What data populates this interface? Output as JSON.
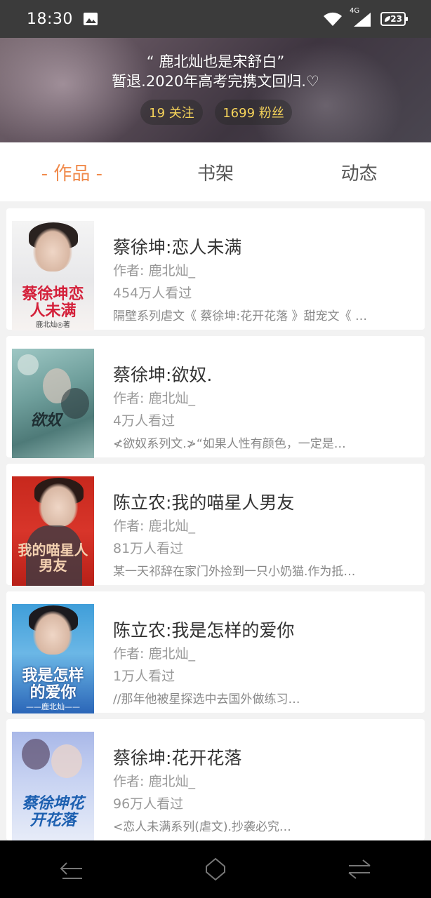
{
  "status_bar": {
    "time": "18:30",
    "network": "4G",
    "battery": "23",
    "icons": [
      "image-icon",
      "wifi-icon",
      "signal-icon",
      "battery-icon"
    ]
  },
  "header": {
    "bio_line1": "“ 鹿北灿也是宋舒白”",
    "bio_line2": "暂退.2020年高考完携文回归.♡",
    "follow_label": "19 关注",
    "fans_label": "1699 粉丝"
  },
  "tabs": [
    {
      "label": "- 作品 -",
      "active": true
    },
    {
      "label": "书架",
      "active": false
    },
    {
      "label": "动态",
      "active": false
    }
  ],
  "books": [
    {
      "title": "蔡徐坤:恋人未满",
      "author": "作者: 鹿北灿_",
      "views": "454万人看过",
      "desc": "隔壁系列虐文《 蔡徐坤:花开花落 》甜宠文《 …",
      "cover_text": "蔡徐坤恋人未满",
      "cover_author": "鹿北灿◎著"
    },
    {
      "title": "蔡徐坤:欲奴.",
      "author": "作者: 鹿北灿_",
      "views": "4万人看过",
      "desc": "≮欲奴系列文.≯“如果人性有颜色，一定是…",
      "cover_text": "欲奴"
    },
    {
      "title": "陈立农:我的喵星人男友",
      "author": "作者: 鹿北灿_",
      "views": "81万人看过",
      "desc": "某一天祁辞在家门外捡到一只小奶猫.作为抵…",
      "cover_text": "我的喵星人男友"
    },
    {
      "title": "陈立农:我是怎样的爱你",
      "author": "作者: 鹿北灿_",
      "views": "1万人看过",
      "desc": "//那年他被星探选中去国外做练习…",
      "cover_text": "我是怎样的爱你",
      "cover_author": "——鹿北灿——"
    },
    {
      "title": "蔡徐坤:花开花落",
      "author": "作者: 鹿北灿_",
      "views": "96万人看过",
      "desc": "<恋人未满系列(虐文).抄袭必究…",
      "cover_text": "蔡徐坤花开花落"
    }
  ],
  "nav_bar": {
    "icons": [
      "back-icon",
      "home-icon",
      "recents-icon"
    ]
  },
  "colors": {
    "accent": "#f08a4b",
    "pill_text": "#f5d35a"
  }
}
